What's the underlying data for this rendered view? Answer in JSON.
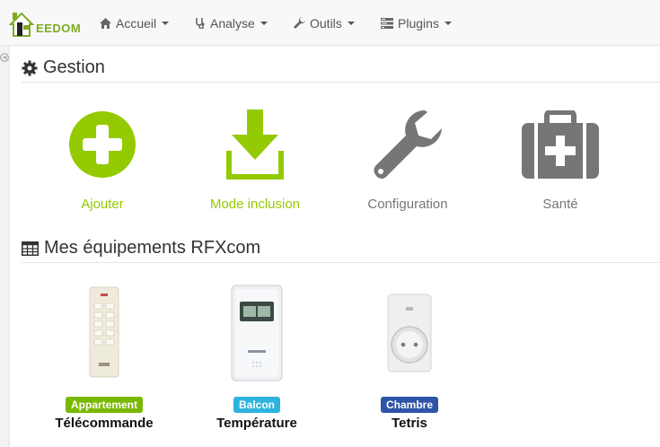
{
  "app": {
    "logo_text": "EEDOM"
  },
  "navbar": {
    "items": [
      {
        "label": "Accueil",
        "icon": "home-icon"
      },
      {
        "label": "Analyse",
        "icon": "stethoscope-icon"
      },
      {
        "label": "Outils",
        "icon": "wrench-icon"
      },
      {
        "label": "Plugins",
        "icon": "tasks-icon"
      }
    ]
  },
  "gestion": {
    "title": "Gestion",
    "actions": [
      {
        "label": "Ajouter",
        "icon": "plus-circle-icon",
        "color": "#94ca02"
      },
      {
        "label": "Mode inclusion",
        "icon": "download-icon",
        "color": "#94ca02"
      },
      {
        "label": "Configuration",
        "icon": "wrench-icon",
        "color": "#767676"
      },
      {
        "label": "Santé",
        "icon": "medkit-icon",
        "color": "#767676"
      }
    ]
  },
  "equipements": {
    "title": "Mes équipements RFXcom",
    "items": [
      {
        "badge": "Appartement",
        "badge_color": "#7ab800",
        "name": "Télécommande",
        "image": "remote-control-image"
      },
      {
        "badge": "Balcon",
        "badge_color": "#2db3de",
        "name": "Température",
        "image": "temperature-sensor-image"
      },
      {
        "badge": "Chambre",
        "badge_color": "#3055a8",
        "name": "Tetris",
        "image": "smart-plug-image"
      }
    ]
  }
}
